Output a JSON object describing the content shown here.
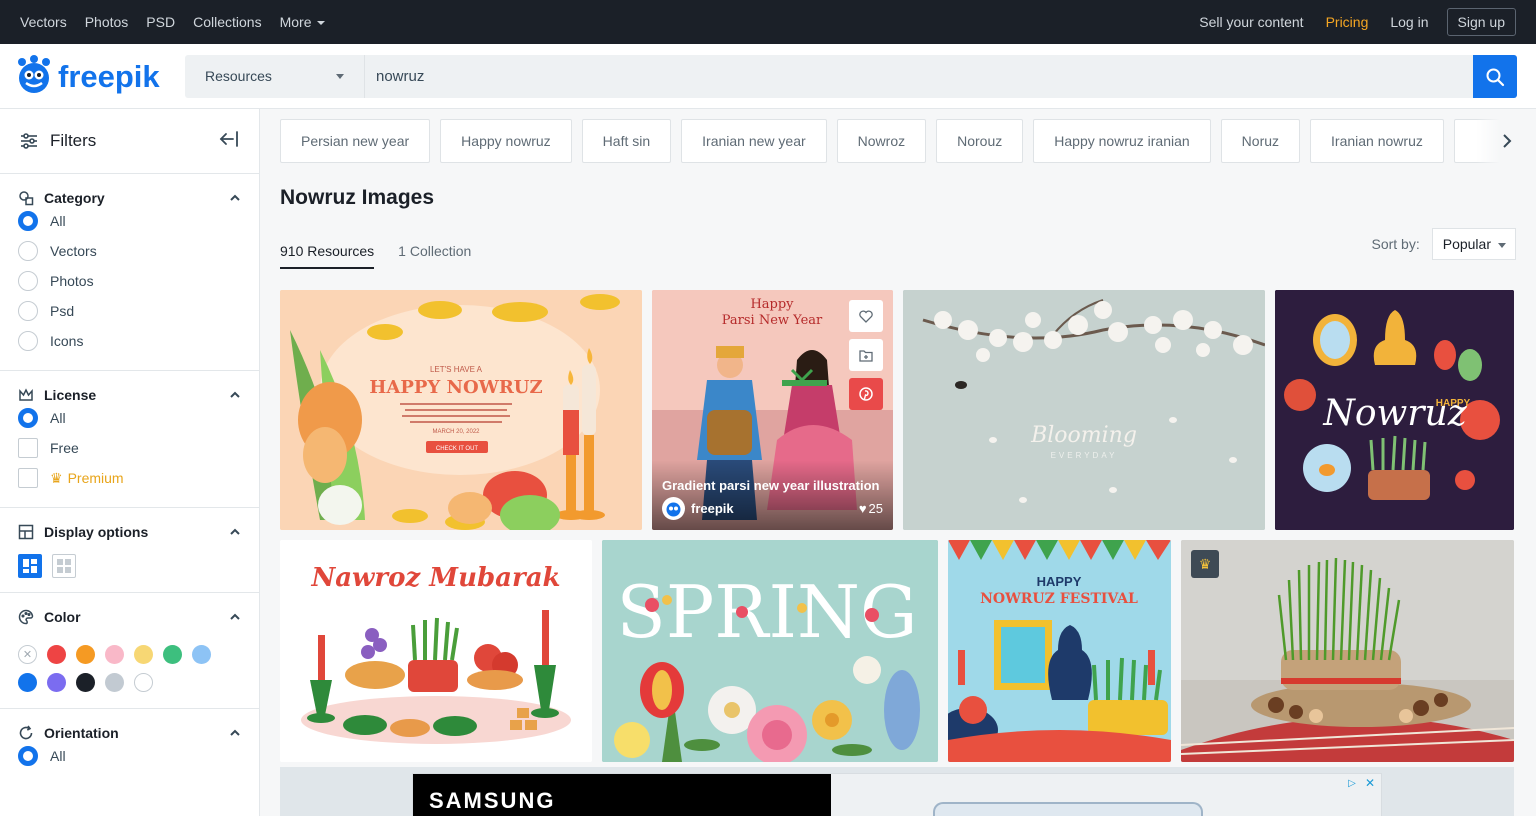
{
  "topnav": {
    "items": [
      "Vectors",
      "Photos",
      "PSD",
      "Collections",
      "More"
    ],
    "right": {
      "sell": "Sell your content",
      "pricing": "Pricing",
      "login": "Log in",
      "signup": "Sign up"
    }
  },
  "brand": {
    "logo_text": "freepik",
    "accent": "#1273eb"
  },
  "search": {
    "type": "Resources",
    "query": "nowruz"
  },
  "sidebar": {
    "header": "Filters",
    "category": {
      "title": "Category",
      "options": [
        "All",
        "Vectors",
        "Photos",
        "Psd",
        "Icons"
      ],
      "selected": "All"
    },
    "license": {
      "title": "License",
      "options": [
        "All",
        "Free",
        "Premium"
      ],
      "selected": "All"
    },
    "display": {
      "title": "Display options"
    },
    "color": {
      "title": "Color",
      "swatches": [
        "none",
        "#ee4444",
        "#f59a23",
        "#f9b8c8",
        "#f7d774",
        "#3dbf7e",
        "#8dc3f5",
        "#1273eb",
        "#7b6cf0",
        "#1b2028",
        "#c2cad2",
        "#ffffff"
      ]
    },
    "orientation": {
      "title": "Orientation",
      "options": [
        "All"
      ],
      "selected": "All"
    }
  },
  "tags": [
    "Persian new year",
    "Happy nowruz",
    "Haft sin",
    "Iranian new year",
    "Nowroz",
    "Norouz",
    "Happy nowruz iranian",
    "Noruz",
    "Iranian nowruz"
  ],
  "page": {
    "title": "Nowruz Images"
  },
  "tabs": [
    {
      "label": "910 Resources",
      "active": true
    },
    {
      "label": "1 Collection",
      "active": false
    }
  ],
  "sort": {
    "label": "Sort by:",
    "value": "Popular"
  },
  "results": {
    "hovered": {
      "title": "Gradient parsi new year illustration",
      "author": "freepik",
      "likes": "25"
    },
    "image_text": {
      "t1_top": "LET'S HAVE A",
      "t1_main": "HAPPY NOWRUZ",
      "t1_date": "MARCH 20, 2022",
      "t1_btn": "CHECK IT OUT",
      "t2_top": "Happy",
      "t2_main": "Parsi New Year",
      "t3_main": "Blooming",
      "t3_sub": "EVERYDAY",
      "t4_top": "HAPPY",
      "t4_main": "Nowruz",
      "t5_main": "Nawroz Mubarak",
      "t6_main": "SPRING",
      "t7_top": "HAPPY",
      "t7_main": "NOWRUZ FESTIVAL"
    }
  },
  "ad": {
    "brand": "SAMSUNG"
  }
}
